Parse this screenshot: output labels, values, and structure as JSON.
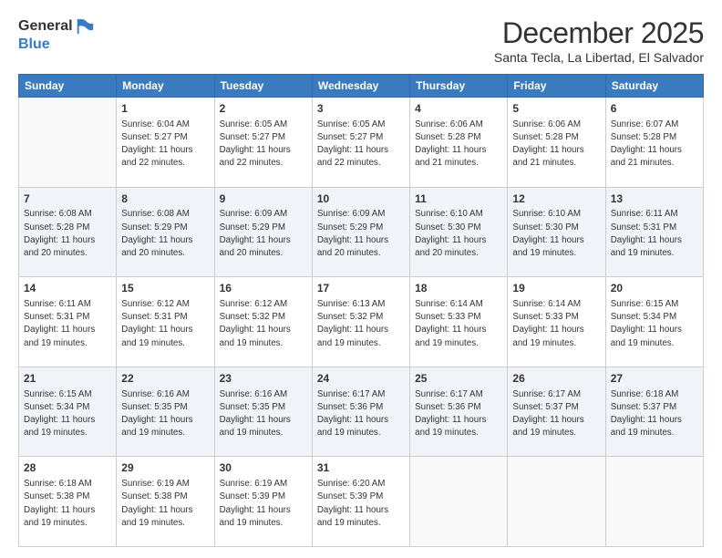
{
  "logo": {
    "general": "General",
    "blue": "Blue"
  },
  "title": "December 2025",
  "location": "Santa Tecla, La Libertad, El Salvador",
  "days_of_week": [
    "Sunday",
    "Monday",
    "Tuesday",
    "Wednesday",
    "Thursday",
    "Friday",
    "Saturday"
  ],
  "weeks": [
    [
      {
        "day": "",
        "info": ""
      },
      {
        "day": "1",
        "info": "Sunrise: 6:04 AM\nSunset: 5:27 PM\nDaylight: 11 hours\nand 22 minutes."
      },
      {
        "day": "2",
        "info": "Sunrise: 6:05 AM\nSunset: 5:27 PM\nDaylight: 11 hours\nand 22 minutes."
      },
      {
        "day": "3",
        "info": "Sunrise: 6:05 AM\nSunset: 5:27 PM\nDaylight: 11 hours\nand 22 minutes."
      },
      {
        "day": "4",
        "info": "Sunrise: 6:06 AM\nSunset: 5:28 PM\nDaylight: 11 hours\nand 21 minutes."
      },
      {
        "day": "5",
        "info": "Sunrise: 6:06 AM\nSunset: 5:28 PM\nDaylight: 11 hours\nand 21 minutes."
      },
      {
        "day": "6",
        "info": "Sunrise: 6:07 AM\nSunset: 5:28 PM\nDaylight: 11 hours\nand 21 minutes."
      }
    ],
    [
      {
        "day": "7",
        "info": "Sunrise: 6:08 AM\nSunset: 5:28 PM\nDaylight: 11 hours\nand 20 minutes."
      },
      {
        "day": "8",
        "info": "Sunrise: 6:08 AM\nSunset: 5:29 PM\nDaylight: 11 hours\nand 20 minutes."
      },
      {
        "day": "9",
        "info": "Sunrise: 6:09 AM\nSunset: 5:29 PM\nDaylight: 11 hours\nand 20 minutes."
      },
      {
        "day": "10",
        "info": "Sunrise: 6:09 AM\nSunset: 5:29 PM\nDaylight: 11 hours\nand 20 minutes."
      },
      {
        "day": "11",
        "info": "Sunrise: 6:10 AM\nSunset: 5:30 PM\nDaylight: 11 hours\nand 20 minutes."
      },
      {
        "day": "12",
        "info": "Sunrise: 6:10 AM\nSunset: 5:30 PM\nDaylight: 11 hours\nand 19 minutes."
      },
      {
        "day": "13",
        "info": "Sunrise: 6:11 AM\nSunset: 5:31 PM\nDaylight: 11 hours\nand 19 minutes."
      }
    ],
    [
      {
        "day": "14",
        "info": "Sunrise: 6:11 AM\nSunset: 5:31 PM\nDaylight: 11 hours\nand 19 minutes."
      },
      {
        "day": "15",
        "info": "Sunrise: 6:12 AM\nSunset: 5:31 PM\nDaylight: 11 hours\nand 19 minutes."
      },
      {
        "day": "16",
        "info": "Sunrise: 6:12 AM\nSunset: 5:32 PM\nDaylight: 11 hours\nand 19 minutes."
      },
      {
        "day": "17",
        "info": "Sunrise: 6:13 AM\nSunset: 5:32 PM\nDaylight: 11 hours\nand 19 minutes."
      },
      {
        "day": "18",
        "info": "Sunrise: 6:14 AM\nSunset: 5:33 PM\nDaylight: 11 hours\nand 19 minutes."
      },
      {
        "day": "19",
        "info": "Sunrise: 6:14 AM\nSunset: 5:33 PM\nDaylight: 11 hours\nand 19 minutes."
      },
      {
        "day": "20",
        "info": "Sunrise: 6:15 AM\nSunset: 5:34 PM\nDaylight: 11 hours\nand 19 minutes."
      }
    ],
    [
      {
        "day": "21",
        "info": "Sunrise: 6:15 AM\nSunset: 5:34 PM\nDaylight: 11 hours\nand 19 minutes."
      },
      {
        "day": "22",
        "info": "Sunrise: 6:16 AM\nSunset: 5:35 PM\nDaylight: 11 hours\nand 19 minutes."
      },
      {
        "day": "23",
        "info": "Sunrise: 6:16 AM\nSunset: 5:35 PM\nDaylight: 11 hours\nand 19 minutes."
      },
      {
        "day": "24",
        "info": "Sunrise: 6:17 AM\nSunset: 5:36 PM\nDaylight: 11 hours\nand 19 minutes."
      },
      {
        "day": "25",
        "info": "Sunrise: 6:17 AM\nSunset: 5:36 PM\nDaylight: 11 hours\nand 19 minutes."
      },
      {
        "day": "26",
        "info": "Sunrise: 6:17 AM\nSunset: 5:37 PM\nDaylight: 11 hours\nand 19 minutes."
      },
      {
        "day": "27",
        "info": "Sunrise: 6:18 AM\nSunset: 5:37 PM\nDaylight: 11 hours\nand 19 minutes."
      }
    ],
    [
      {
        "day": "28",
        "info": "Sunrise: 6:18 AM\nSunset: 5:38 PM\nDaylight: 11 hours\nand 19 minutes."
      },
      {
        "day": "29",
        "info": "Sunrise: 6:19 AM\nSunset: 5:38 PM\nDaylight: 11 hours\nand 19 minutes."
      },
      {
        "day": "30",
        "info": "Sunrise: 6:19 AM\nSunset: 5:39 PM\nDaylight: 11 hours\nand 19 minutes."
      },
      {
        "day": "31",
        "info": "Sunrise: 6:20 AM\nSunset: 5:39 PM\nDaylight: 11 hours\nand 19 minutes."
      },
      {
        "day": "",
        "info": ""
      },
      {
        "day": "",
        "info": ""
      },
      {
        "day": "",
        "info": ""
      }
    ]
  ]
}
